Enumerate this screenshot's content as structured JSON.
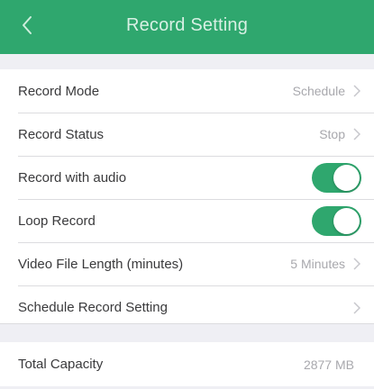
{
  "colors": {
    "accent": "#2fa76e",
    "background": "#efeff4",
    "row_background": "#ffffff",
    "label_text": "#3a3a3c",
    "value_text": "#a8a8ad"
  },
  "header": {
    "title": "Record Setting",
    "back_icon": "chevron-left-icon"
  },
  "settings": {
    "record_mode": {
      "label": "Record Mode",
      "value": "Schedule"
    },
    "record_status": {
      "label": "Record Status",
      "value": "Stop"
    },
    "record_with_audio": {
      "label": "Record with audio",
      "enabled": true
    },
    "loop_record": {
      "label": "Loop Record",
      "enabled": true
    },
    "video_file_length": {
      "label": "Video File Length (minutes)",
      "value": "5 Minutes"
    },
    "schedule_record_setting": {
      "label": "Schedule Record Setting"
    }
  },
  "storage": {
    "total_capacity": {
      "label": "Total Capacity",
      "value": "2877 MB"
    }
  }
}
